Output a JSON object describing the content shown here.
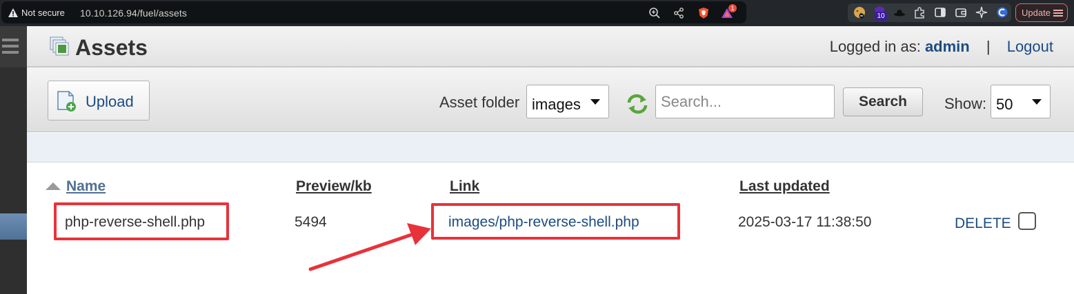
{
  "browser": {
    "security_label": "Not secure",
    "url": "10.10.126.94/fuel/assets",
    "notification_count": "1",
    "extension_badge": "10",
    "update_label": "Update",
    "icons": [
      "zoom-icon",
      "share-icon",
      "brave-shield-icon",
      "brave-rewards-icon",
      "extensions-icon",
      "sidebar-icon",
      "wallet-icon",
      "leo-icon",
      "vpn-icon",
      "menu-icon"
    ]
  },
  "header": {
    "title": "Assets",
    "logged_in_label": "Logged in as:",
    "username": "admin",
    "separator": "|",
    "logout_label": "Logout"
  },
  "toolbar": {
    "upload_label": "Upload",
    "folder_label": "Asset folder",
    "folder_value": "images",
    "search_placeholder": "Search...",
    "search_button": "Search",
    "show_label": "Show:",
    "show_value": "50"
  },
  "table": {
    "columns": {
      "name": "Name",
      "preview": "Preview/kb",
      "link": "Link",
      "updated": "Last updated"
    },
    "sort": {
      "column": "name",
      "direction": "ascending"
    },
    "rows": [
      {
        "name": "php-reverse-shell.php",
        "preview": "5494",
        "link": "images/php-reverse-shell.php",
        "updated": "2025-03-17 11:38:50",
        "action": "DELETE",
        "checked": false
      }
    ]
  },
  "colors": {
    "link_blue": "#1b4b82",
    "annotation_red": "#e8323a",
    "browser_dark": "#23272b"
  }
}
